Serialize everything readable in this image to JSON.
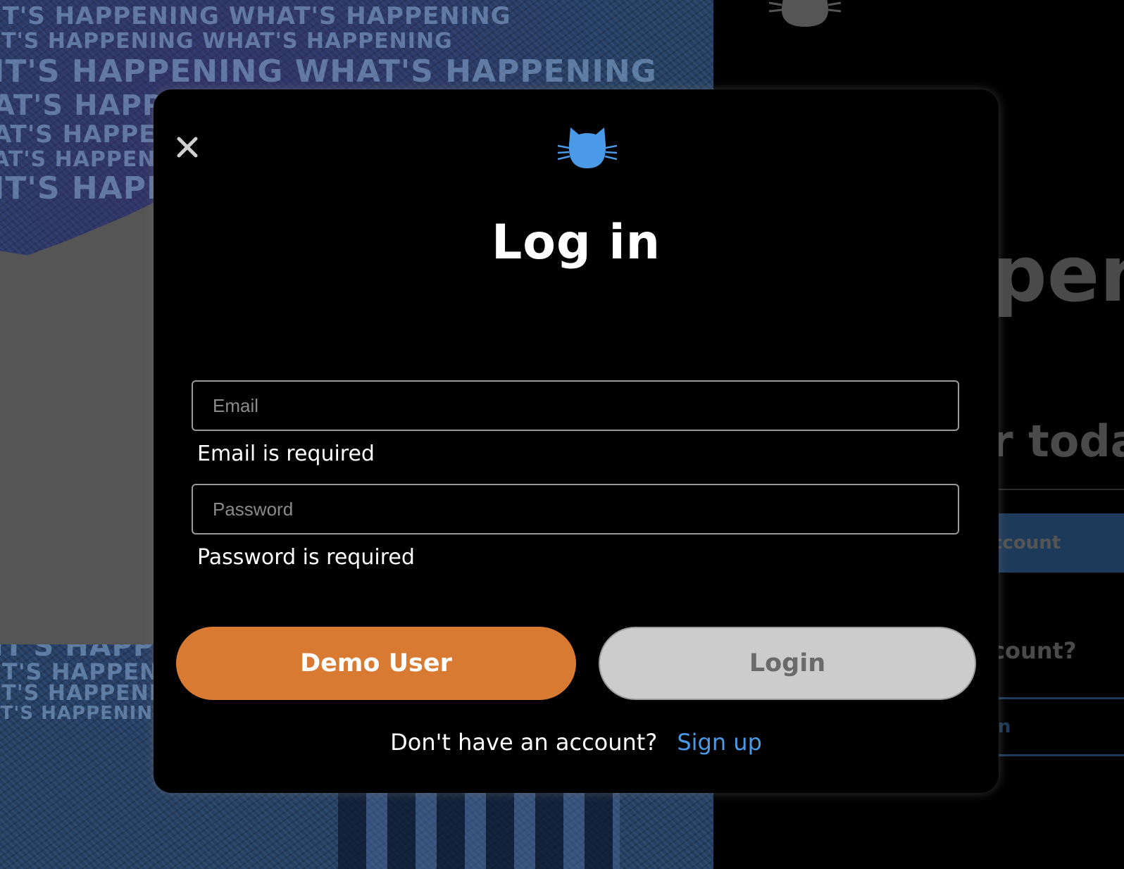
{
  "background": {
    "poster_text": "IT'S HAPPENING WHAT'S HAPPENING",
    "heading_fragment": "pen",
    "subheading_fragment": "r toda",
    "create_account_fragment": "ccount",
    "have_account_fragment": "count?",
    "sign_in_fragment": "in"
  },
  "modal": {
    "close_icon": "close-icon",
    "logo_icon": "cat-logo-icon",
    "title": "Log in",
    "email": {
      "value": "",
      "placeholder": "Email",
      "error": "Email is required"
    },
    "password": {
      "value": "",
      "placeholder": "Password",
      "error": "Password is required"
    },
    "demo_button_label": "Demo User",
    "login_button_label": "Login",
    "signup_prompt": "Don't have an account?",
    "signup_link_label": "Sign up"
  },
  "colors": {
    "accent_orange": "#d97a32",
    "link_blue": "#4b9ae8",
    "logo_blue": "#4b9ae8",
    "disabled_gray": "#cccccc"
  }
}
